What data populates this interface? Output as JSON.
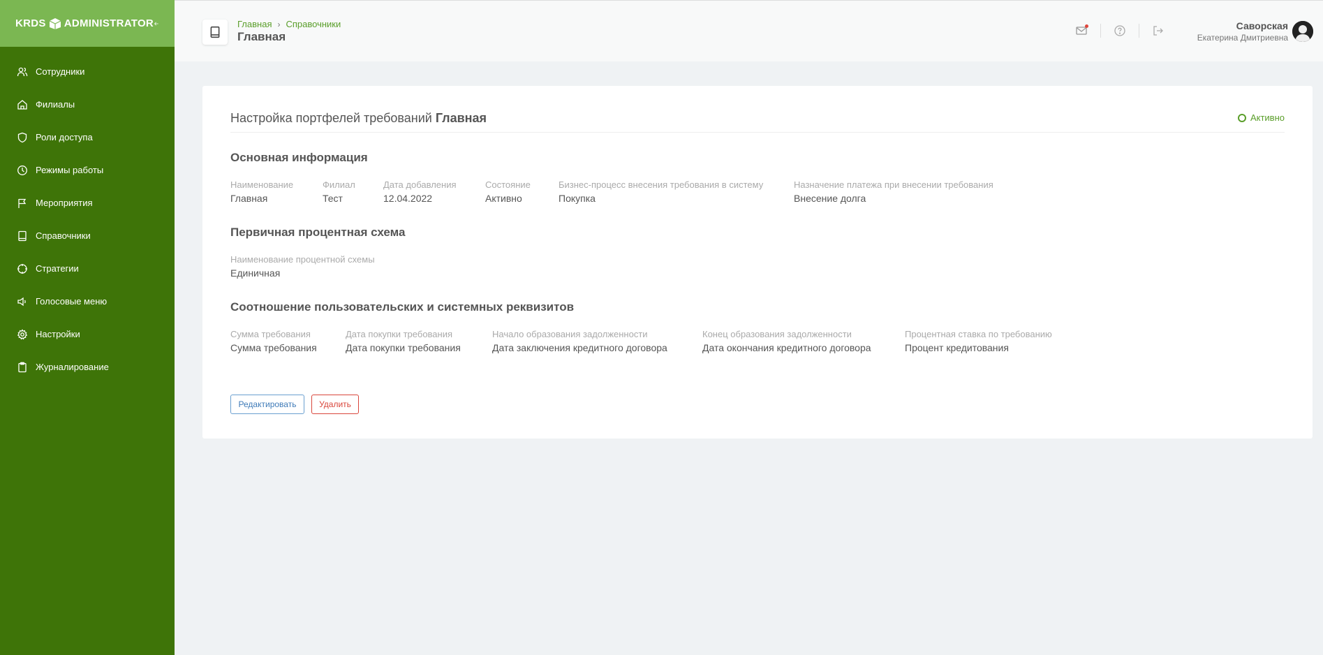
{
  "app": {
    "logo_left": "KRDS",
    "logo_right": "ADMINISTRATOR"
  },
  "sidebar": {
    "items": [
      {
        "label": "Сотрудники",
        "icon": "users-icon"
      },
      {
        "label": "Филиалы",
        "icon": "home-icon"
      },
      {
        "label": "Роли доступа",
        "icon": "shield-icon"
      },
      {
        "label": "Режимы работы",
        "icon": "clock-icon"
      },
      {
        "label": "Мероприятия",
        "icon": "flag-icon"
      },
      {
        "label": "Справочники",
        "icon": "book-icon"
      },
      {
        "label": "Стратегии",
        "icon": "crosshair-icon"
      },
      {
        "label": "Голосовые меню",
        "icon": "speaker-icon"
      },
      {
        "label": "Настройки",
        "icon": "gear-icon"
      },
      {
        "label": "Журналирование",
        "icon": "clipboard-icon"
      }
    ]
  },
  "header": {
    "breadcrumb": [
      "Главная",
      "Справочники"
    ],
    "title": "Главная",
    "user_name": "Саворская",
    "user_fullname": "Екатерина Дмитриевна"
  },
  "card": {
    "title_prefix": "Настройка портфелей требований",
    "title_bold": "Главная",
    "status": "Активно",
    "sections": {
      "main_info": {
        "title": "Основная информация",
        "fields": [
          {
            "label": "Наименование",
            "value": "Главная"
          },
          {
            "label": "Филиал",
            "value": "Тест"
          },
          {
            "label": "Дата добавления",
            "value": "12.04.2022"
          },
          {
            "label": "Состояние",
            "value": "Активно"
          },
          {
            "label": "Бизнес-процесс внесения требования в систему",
            "value": "Покупка"
          },
          {
            "label": "Назначение платежа при внесении требования",
            "value": "Внесение долга"
          }
        ]
      },
      "interest": {
        "title": "Первичная процентная схема",
        "fields": [
          {
            "label": "Наименование процентной схемы",
            "value": "Единичная"
          }
        ]
      },
      "mapping": {
        "title": "Соотношение пользовательских и системных реквизитов",
        "fields": [
          {
            "label": "Сумма требования",
            "value": "Сумма требования"
          },
          {
            "label": "Дата покупки требования",
            "value": "Дата покупки требования"
          },
          {
            "label": "Начало образования задолженности",
            "value": "Дата заключения кредитного договора"
          },
          {
            "label": "Конец образования задолженности",
            "value": "Дата окончания кредитного договора"
          },
          {
            "label": "Процентная ставка по требованию",
            "value": "Процент кредитования"
          }
        ]
      }
    },
    "buttons": {
      "edit": "Редактировать",
      "delete": "Удалить"
    }
  },
  "colors": {
    "sidebar_bg": "#3e7408",
    "sidebar_header_bg": "#7bb752",
    "accent_green": "#5a9e2a",
    "edit_blue": "#3f7bb8",
    "delete_red": "#d9463b"
  }
}
